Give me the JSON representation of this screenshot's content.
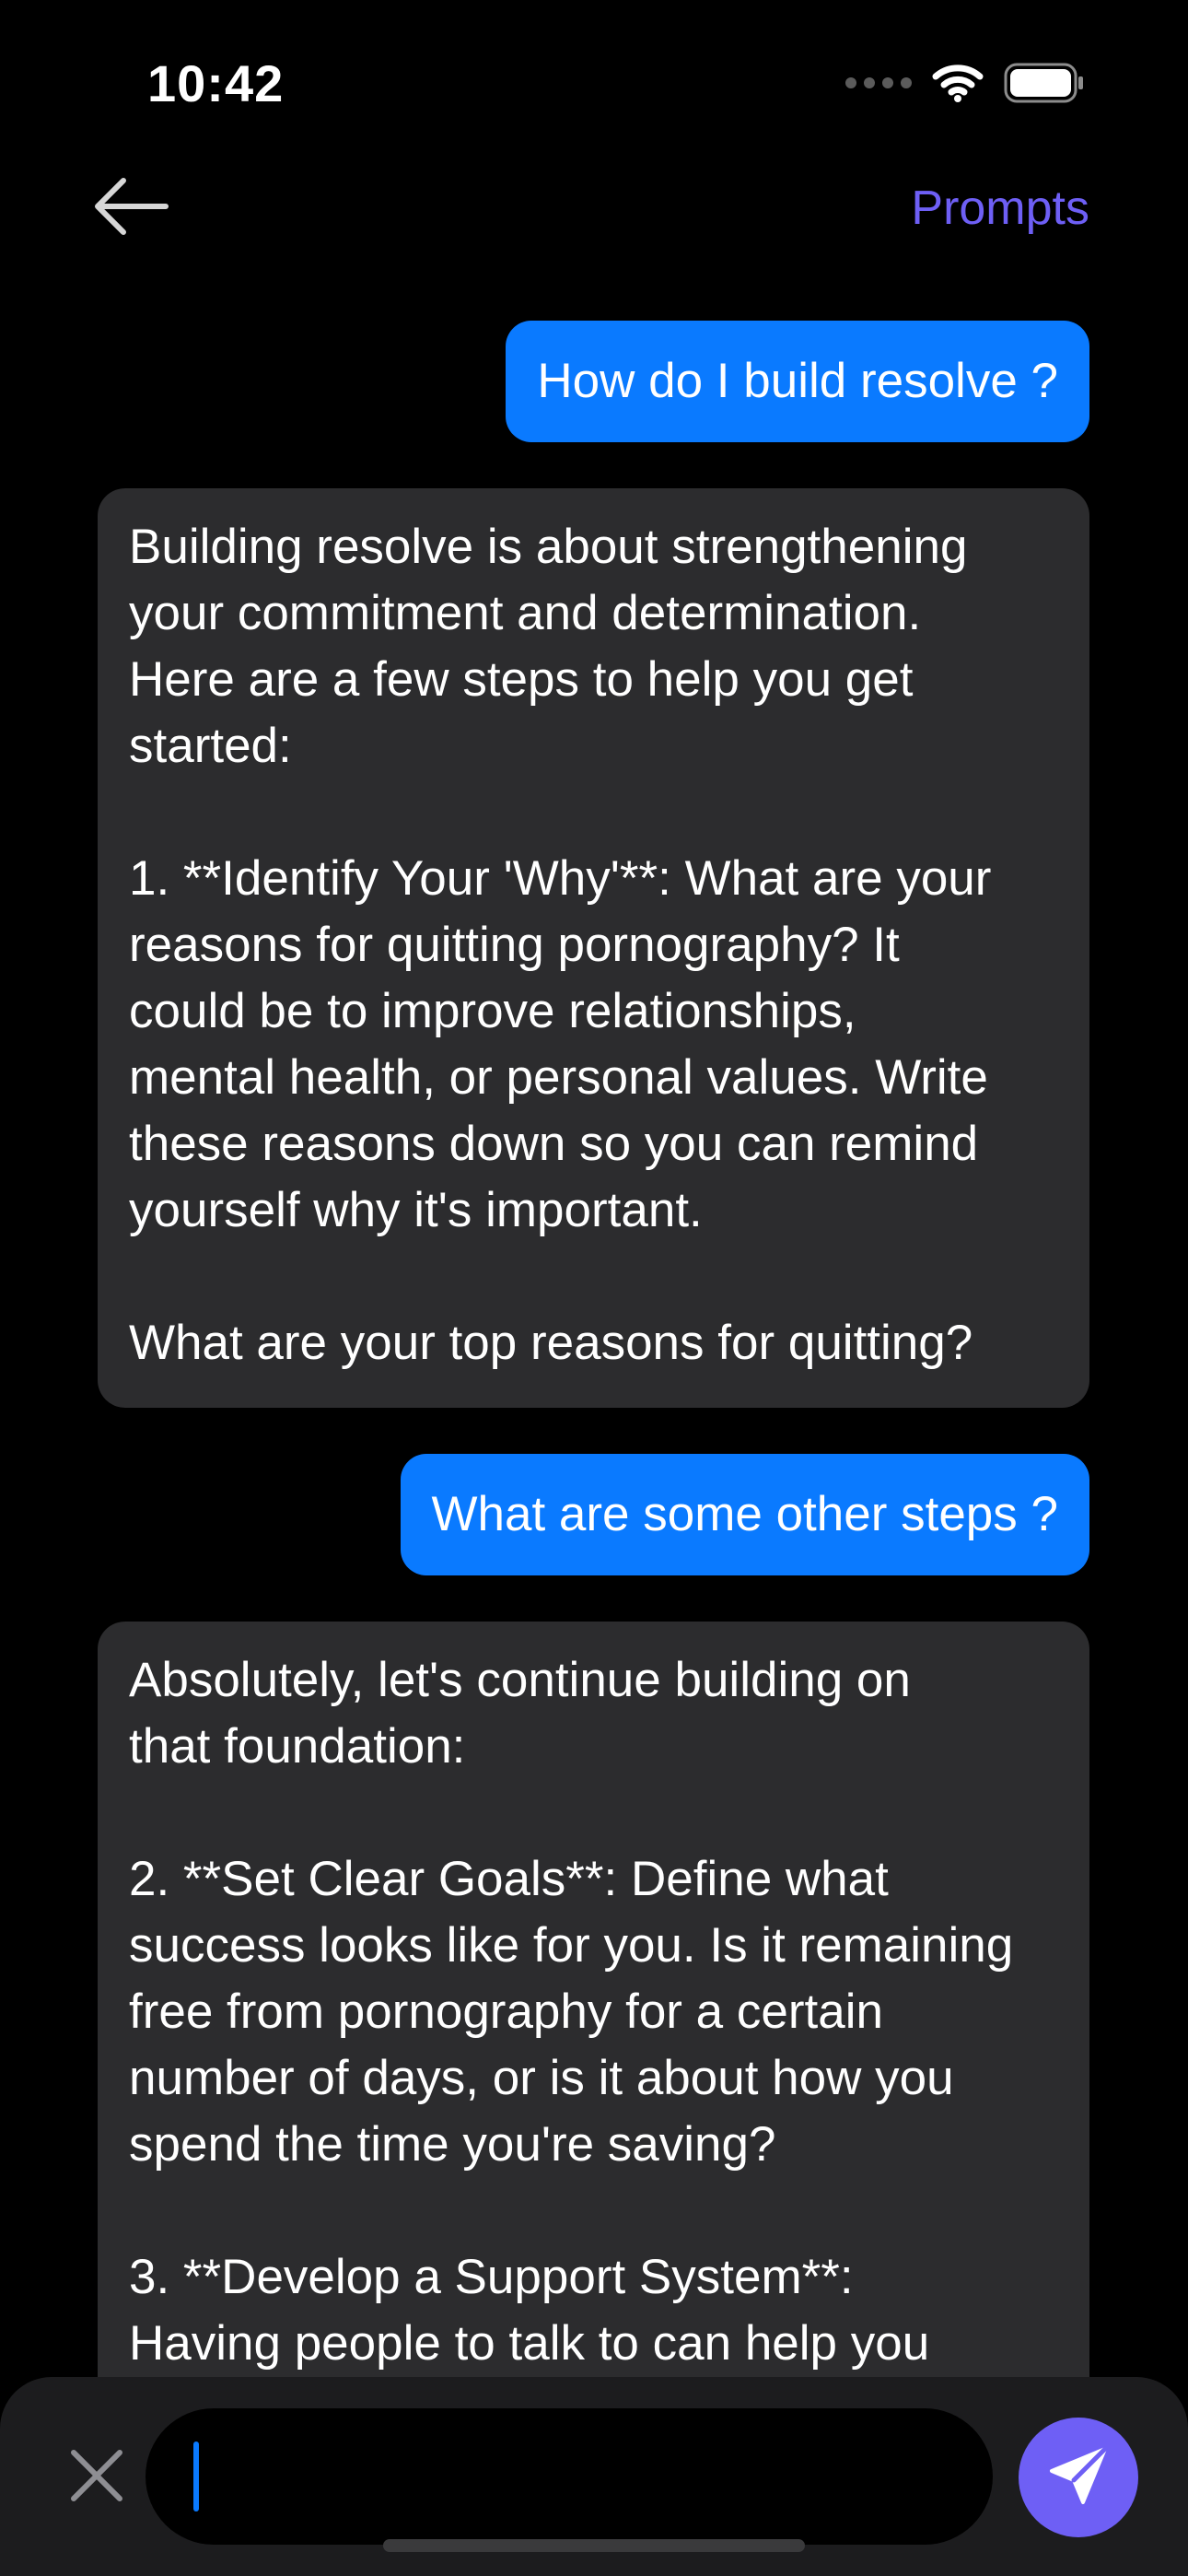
{
  "status_bar": {
    "time": "10:42",
    "wifi_icon": "wifi-icon",
    "battery_icon": "battery-icon"
  },
  "header": {
    "back_icon": "arrow-left-icon",
    "prompts_label": "Prompts"
  },
  "messages": [
    {
      "role": "user",
      "text": "How do I build resolve ?"
    },
    {
      "role": "assistant",
      "text": "Building resolve is about strengthening\nyour commitment and determination.\nHere are a few steps to help you get\nstarted:\n\n1. **Identify Your 'Why'**: What are your\nreasons for quitting pornography? It\ncould be to improve relationships,\nmental health, or personal values. Write\nthese reasons down so you can remind\nyourself why it's important.\n\nWhat are your top reasons for quitting?"
    },
    {
      "role": "user",
      "text": "What are some other steps ?"
    },
    {
      "role": "assistant",
      "text": "Absolutely, let's continue building on\nthat foundation:\n\n2. **Set Clear Goals**: Define what\nsuccess looks like for you. Is it remaining\nfree from pornography for a certain\nnumber of days, or is it about how you\nspend the time you're saving?\n\n3. **Develop a Support System**:\nHaving people to talk to can help you"
    }
  ],
  "composer": {
    "clear_icon": "close-icon",
    "input_value": "",
    "send_icon": "paper-plane-icon"
  },
  "colors": {
    "background": "#000000",
    "user_bubble": "#0a7aff",
    "assistant_bubble": "#2c2c2e",
    "accent": "#6e5ff5",
    "input_bar": "#1c1c1e"
  }
}
